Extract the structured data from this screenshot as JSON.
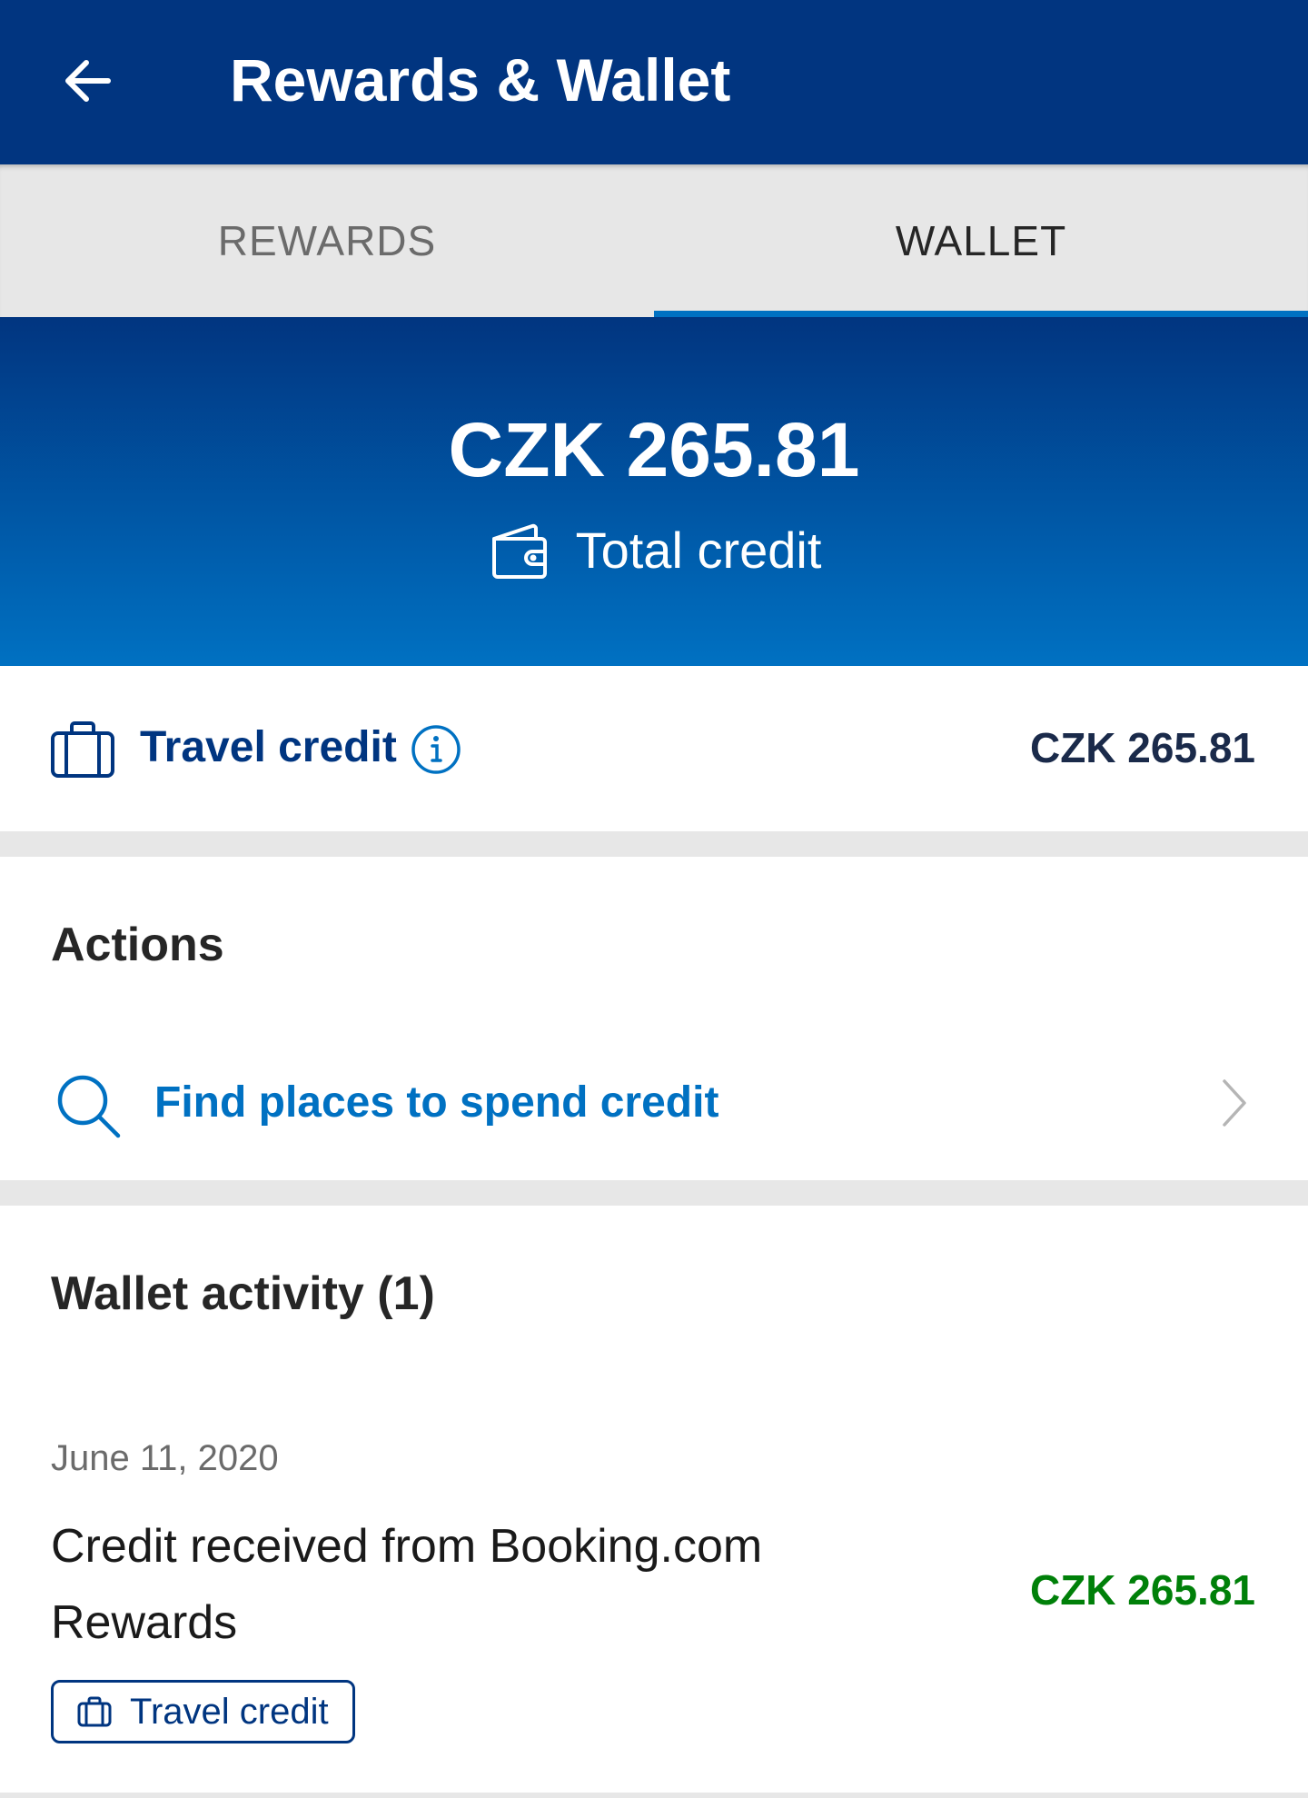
{
  "header": {
    "title": "Rewards & Wallet",
    "back_icon": "arrow-left-icon"
  },
  "tabs": [
    {
      "label": "REWARDS",
      "active": false
    },
    {
      "label": "WALLET",
      "active": true
    }
  ],
  "hero": {
    "amount": "CZK 265.81",
    "label": "Total credit",
    "icon": "wallet-icon"
  },
  "travel_credit": {
    "label": "Travel credit",
    "amount": "CZK 265.81",
    "icon": "suitcase-icon",
    "info_icon": "info-icon"
  },
  "actions": {
    "title": "Actions",
    "items": [
      {
        "label": "Find places to spend credit",
        "icon": "search-icon"
      }
    ]
  },
  "activity": {
    "title": "Wallet activity (1)",
    "items": [
      {
        "date": "June 11, 2020",
        "description": "Credit received from Booking.com Rewards",
        "amount": "CZK 265.81",
        "badge": "Travel credit"
      }
    ]
  },
  "colors": {
    "brand_dark": "#013580",
    "brand_blue": "#0071c2",
    "positive_green": "#008009",
    "divider": "#e7e7e7"
  }
}
